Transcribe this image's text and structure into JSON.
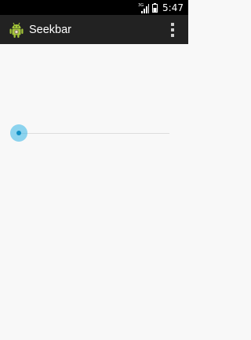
{
  "status_bar": {
    "network_label": "3G",
    "time": "5:47",
    "icons": [
      "signal-icon",
      "battery-icon"
    ]
  },
  "action_bar": {
    "title": "Seekbar",
    "app_icon": "android-robot-icon",
    "overflow_icon": "overflow-menu-icon"
  },
  "seekbar": {
    "progress": 0,
    "max": 100
  },
  "colors": {
    "accent": "#33b5e5",
    "actionbar": "#222222",
    "background": "#f8f8f8"
  }
}
